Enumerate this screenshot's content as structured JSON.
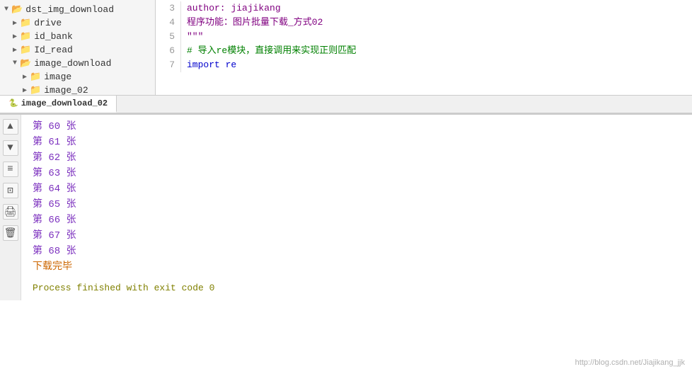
{
  "fileTree": {
    "items": [
      {
        "id": "dst_img_download",
        "label": "dst_img_download",
        "indent": 0,
        "type": "folder-open",
        "arrow": "▼"
      },
      {
        "id": "drive",
        "label": "drive",
        "indent": 1,
        "type": "folder",
        "arrow": "▶"
      },
      {
        "id": "id_bank",
        "label": "id_bank",
        "indent": 1,
        "type": "folder",
        "arrow": "▶"
      },
      {
        "id": "Id_read",
        "label": "Id_read",
        "indent": 1,
        "type": "folder",
        "arrow": "▶"
      },
      {
        "id": "image_download",
        "label": "image_download",
        "indent": 1,
        "type": "folder-open",
        "arrow": "▼"
      },
      {
        "id": "image",
        "label": "image",
        "indent": 2,
        "type": "folder",
        "arrow": "▶"
      },
      {
        "id": "image_02",
        "label": "image_02",
        "indent": 2,
        "type": "folder",
        "arrow": "▶"
      }
    ]
  },
  "codeLines": [
    {
      "num": "3",
      "text": "author: jiajikang",
      "style": "purple"
    },
    {
      "num": "4",
      "text": "程序功能：图片批量下载_方式02",
      "style": "purple"
    },
    {
      "num": "5",
      "text": "\"\"\"",
      "style": "purple"
    },
    {
      "num": "6",
      "text": "#  导入re模块，直接调用来实现正则匹配",
      "style": "green"
    },
    {
      "num": "7",
      "text": "import re",
      "style": "blue"
    }
  ],
  "activeTab": "image_download_02",
  "outputLines": [
    {
      "text": "第 60 张"
    },
    {
      "text": "第 61 张"
    },
    {
      "text": "第 62 张"
    },
    {
      "text": "第 63 张"
    },
    {
      "text": "第 64 张"
    },
    {
      "text": "第 65 张"
    },
    {
      "text": "第 66 张"
    },
    {
      "text": "第 67 张"
    },
    {
      "text": "第 68 张"
    }
  ],
  "completeText": "下载完毕",
  "processText": "Process finished with exit code 0",
  "watermark": "http://blog.csdn.net/Jiajikang_jjk",
  "sidebarButtons": [
    {
      "icon": "▲",
      "name": "up"
    },
    {
      "icon": "▼",
      "name": "down"
    },
    {
      "icon": "≡",
      "name": "rerun"
    },
    {
      "icon": "⊡",
      "name": "stop"
    },
    {
      "icon": "🖨",
      "name": "print"
    },
    {
      "icon": "🗑",
      "name": "clear"
    }
  ]
}
